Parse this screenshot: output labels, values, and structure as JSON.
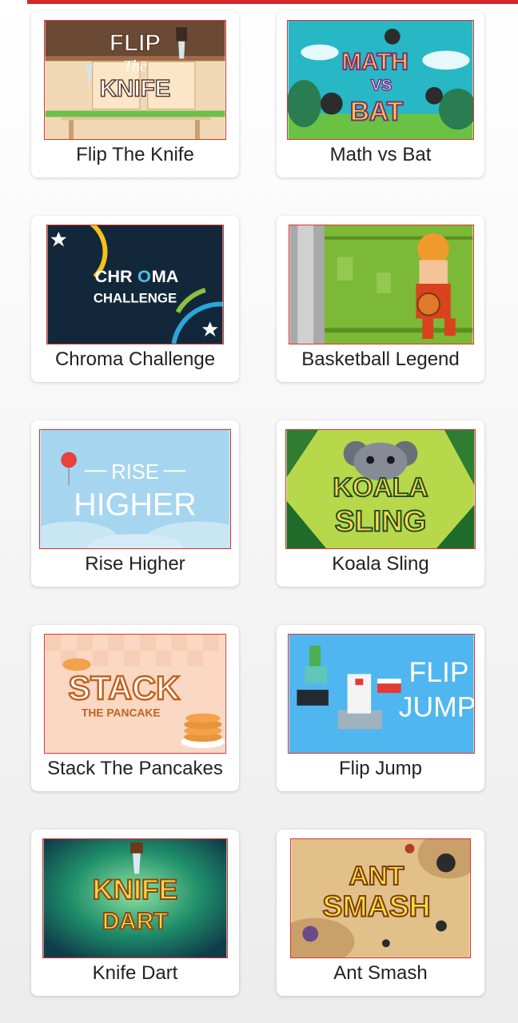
{
  "games": [
    {
      "title": "Flip The Knife",
      "art_text": [
        "FLIP",
        "The",
        "KNIFE"
      ]
    },
    {
      "title": "Math vs Bat",
      "art_text": [
        "MATH",
        "VS",
        "BAT"
      ]
    },
    {
      "title": "Chroma Challenge",
      "art_text": [
        "CHR",
        "O",
        "MA",
        "CHALLENGE"
      ]
    },
    {
      "title": "Basketball Legend",
      "art_text": []
    },
    {
      "title": "Rise Higher",
      "art_text": [
        "RISE",
        "HIGHER"
      ]
    },
    {
      "title": "Koala Sling",
      "art_text": [
        "KOALA",
        "SLING"
      ]
    },
    {
      "title": "Stack The Pancakes",
      "art_text": [
        "STACK",
        "THE PANCAKE"
      ]
    },
    {
      "title": "Flip Jump",
      "art_text": [
        "FLIP",
        "JUMP"
      ]
    },
    {
      "title": "Knife Dart",
      "art_text": [
        "KNIFE",
        "DART"
      ]
    },
    {
      "title": "Ant Smash",
      "art_text": [
        "ANT",
        "SMASH"
      ]
    }
  ],
  "colors": {
    "accent": "#d4282a",
    "thumb_border": "#e0322e"
  }
}
